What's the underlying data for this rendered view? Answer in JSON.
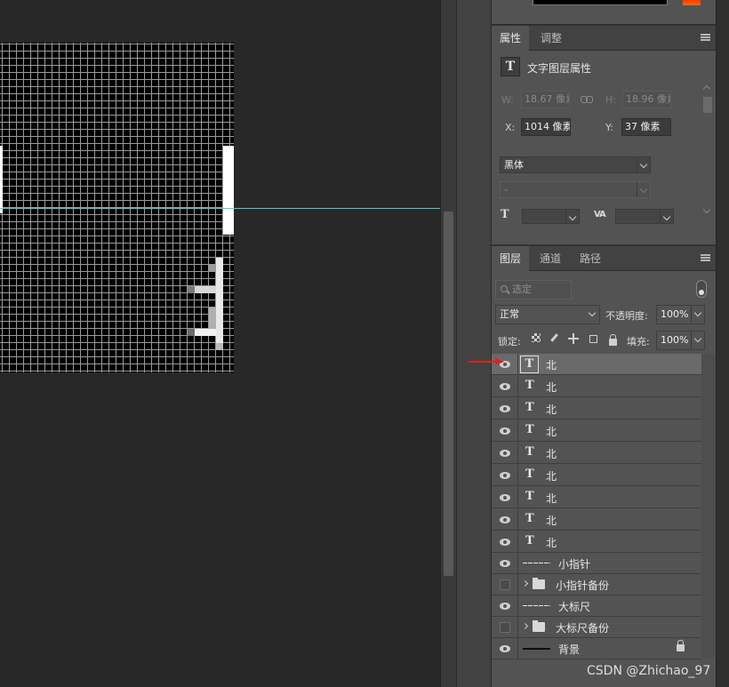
{
  "properties_panel": {
    "tabs": [
      "属性",
      "调整"
    ],
    "header_icon": "T",
    "title": "文字图层属性",
    "w_label": "W:",
    "w_value": "18.67 像素",
    "h_label": "H:",
    "h_value": "18.96 像素",
    "x_label": "X:",
    "x_value": "1014 像素",
    "y_label": "Y:",
    "y_value": "37 像素",
    "font_family": "黑体",
    "font_style": "-"
  },
  "layers_panel": {
    "tabs": [
      "图层",
      "通道",
      "路径"
    ],
    "filter_placeholder": "选定",
    "blend_mode": "正常",
    "opacity_label": "不透明度:",
    "opacity_value": "100%",
    "lock_label": "锁定:",
    "fill_label": "填充:",
    "fill_value": "100%",
    "layers": [
      {
        "name": "北",
        "type_icon": "T"
      },
      {
        "name": "北",
        "type_icon": "T"
      },
      {
        "name": "北",
        "type_icon": "T"
      },
      {
        "name": "北",
        "type_icon": "T"
      },
      {
        "name": "北",
        "type_icon": "T"
      },
      {
        "name": "北",
        "type_icon": "T"
      },
      {
        "name": "北",
        "type_icon": "T"
      },
      {
        "name": "北",
        "type_icon": "T"
      },
      {
        "name": "北",
        "type_icon": "T"
      },
      {
        "name": "小指针"
      },
      {
        "name": "小指针备份"
      },
      {
        "name": "大标尺"
      },
      {
        "name": "大标尺备份"
      },
      {
        "name": "背景"
      }
    ]
  },
  "watermark": "CSDN @Zhichao_97",
  "colors": {
    "panel_bg": "#535353",
    "guide": "#3fd3d8",
    "arrow": "#e02020",
    "swatch": "#ff4a00"
  }
}
